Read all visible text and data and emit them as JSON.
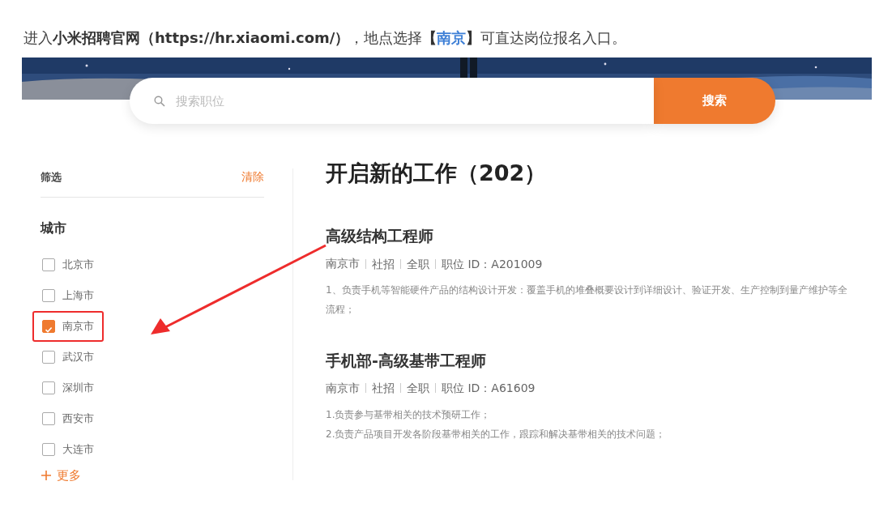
{
  "caption": [
    {
      "kind": "plain",
      "text": "进入"
    },
    {
      "kind": "bold",
      "text": "小米招聘官网（https://hr.xiaomi.com/）"
    },
    {
      "kind": "plain",
      "text": "，地点选择"
    },
    {
      "kind": "bold",
      "text": "【"
    },
    {
      "kind": "accent",
      "text": "南京"
    },
    {
      "kind": "bold",
      "text": "】"
    },
    {
      "kind": "plain",
      "text": "可直达岗位报名入口。"
    }
  ],
  "search": {
    "placeholder": "搜索职位",
    "button": "搜索"
  },
  "filter": {
    "title": "筛选",
    "clear": "清除",
    "group": "城市",
    "cities": [
      {
        "label": "北京市",
        "checked": false,
        "highlighted": false
      },
      {
        "label": "上海市",
        "checked": false,
        "highlighted": false
      },
      {
        "label": "南京市",
        "checked": true,
        "highlighted": true
      },
      {
        "label": "武汉市",
        "checked": false,
        "highlighted": false
      },
      {
        "label": "深圳市",
        "checked": false,
        "highlighted": false
      },
      {
        "label": "西安市",
        "checked": false,
        "highlighted": false
      },
      {
        "label": "大连市",
        "checked": false,
        "highlighted": false
      }
    ],
    "more": "更多"
  },
  "results": {
    "title": "开启新的工作（202）",
    "jobs": [
      {
        "title": "高级结构工程师",
        "meta": [
          "南京市",
          "社招",
          "全职",
          "职位 ID：A201009"
        ],
        "description": [
          "1、负责手机等智能硬件产品的结构设计开发：覆盖手机的堆叠概要设计到详细设计、验证开发、生产控制到量产维护等全流程；"
        ]
      },
      {
        "title": "手机部-高级基带工程师",
        "meta": [
          "南京市",
          "社招",
          "全职",
          "职位 ID：A61609"
        ],
        "description": [
          "1.负责参与基带相关的技术预研工作；",
          "2.负责产品项目开发各阶段基带相关的工作，跟踪和解决基带相关的技术问题；"
        ]
      }
    ]
  }
}
